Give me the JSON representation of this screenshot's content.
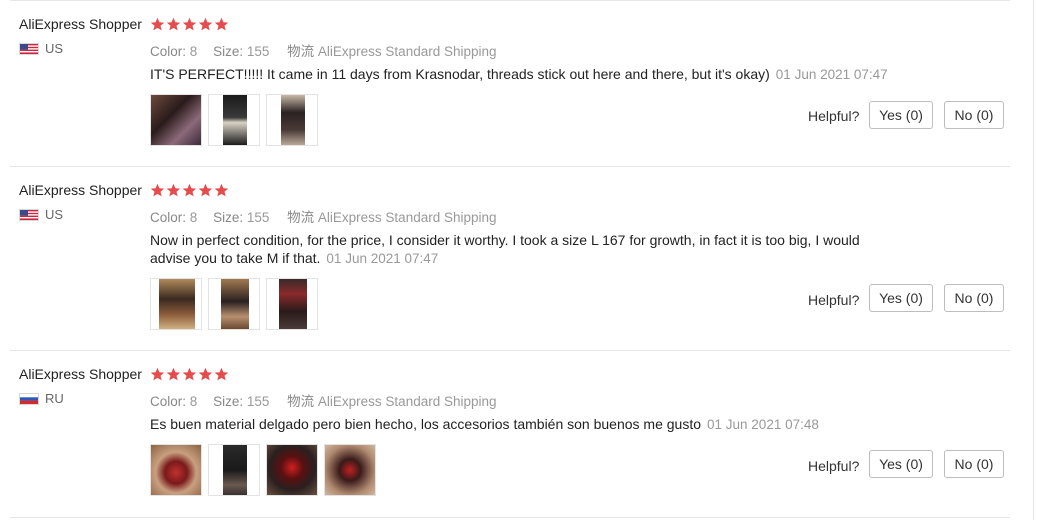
{
  "labels": {
    "color": "Color:",
    "size": "Size:",
    "logistics": "物流",
    "helpful": "Helpful?"
  },
  "colors": {
    "star": "#e74c4c",
    "accent_text": "#222222",
    "muted_text": "#999999"
  },
  "reviews": [
    {
      "user": "AliExpress Shopper",
      "rating": 5,
      "country_code": "US",
      "flag_icon": "us-flag-icon",
      "color": "8",
      "size": "155",
      "shipping": "AliExpress Standard Shipping",
      "text": "IT'S PERFECT!!!!! It came in 11 days from Krasnodar, threads stick out here and there, but it's okay)",
      "date": "01 Jun 2021 07:47",
      "photos": [
        "review-photo-1",
        "review-photo-2",
        "review-photo-3"
      ],
      "yes": "Yes (0)",
      "no": "No (0)"
    },
    {
      "user": "AliExpress Shopper",
      "rating": 5,
      "country_code": "US",
      "flag_icon": "us-flag-icon",
      "color": "8",
      "size": "155",
      "shipping": "AliExpress Standard Shipping",
      "text": "Now in perfect condition, for the price, I consider it worthy. I took a size L 167 for growth, in fact it is too big, I would advise you to take M if that.",
      "date": "01 Jun 2021 07:47",
      "photos": [
        "review-photo-1",
        "review-photo-2",
        "review-photo-3"
      ],
      "yes": "Yes (0)",
      "no": "No (0)"
    },
    {
      "user": "AliExpress Shopper",
      "rating": 5,
      "country_code": "RU",
      "flag_icon": "ru-flag-icon",
      "color": "8",
      "size": "155",
      "shipping": "AliExpress Standard Shipping",
      "text": "Es buen material delgado pero bien hecho, los accesorios también son buenos me gusto",
      "date": "01 Jun 2021 07:48",
      "photos": [
        "review-photo-1",
        "review-photo-2",
        "review-photo-3",
        "review-photo-4"
      ],
      "yes": "Yes (0)",
      "no": "No (0)"
    }
  ]
}
